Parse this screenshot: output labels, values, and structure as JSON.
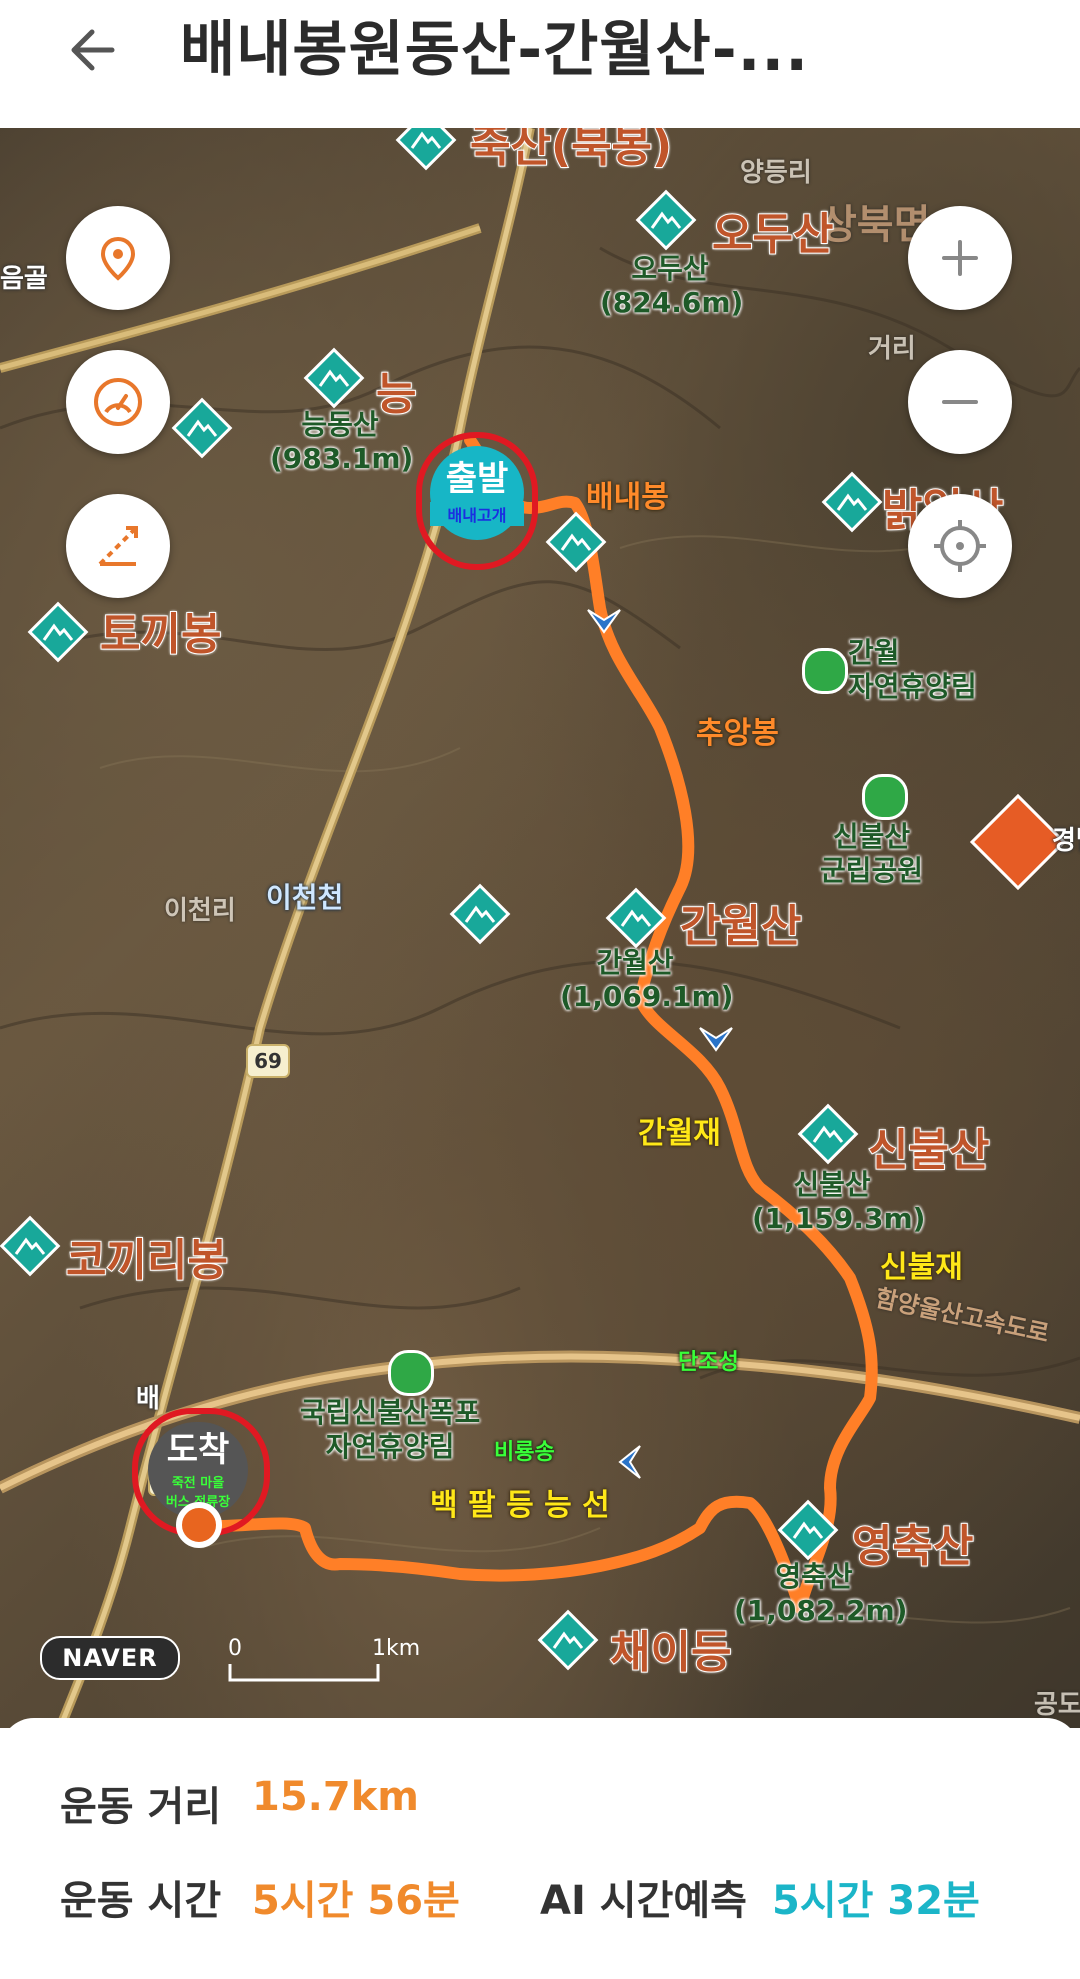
{
  "header": {
    "title": "배내봉원동산-간월산-...",
    "back_icon": "arrow-left-icon"
  },
  "map": {
    "peaks": [
      {
        "id": "juksan",
        "name": "죽산(북봉)"
      },
      {
        "id": "oedusan",
        "name": "오두산",
        "sub": "오두산",
        "elev": "(824.6m)"
      },
      {
        "id": "neungdongsan",
        "name": "능",
        "sub": "능동산",
        "elev": "(983.1m)"
      },
      {
        "id": "balsan",
        "name": "밝얼산"
      },
      {
        "id": "tokkibong",
        "name": "토끼봉"
      },
      {
        "id": "ganwolsan",
        "name": "간월산",
        "sub": "간월산",
        "elev": "(1,069.1m)"
      },
      {
        "id": "sinbulsan",
        "name": "신불산",
        "sub": "신불산",
        "elev": "(1,159.3m)"
      },
      {
        "id": "kokkiribong",
        "name": "코끼리봉"
      },
      {
        "id": "yeongchuksan",
        "name": "영축산",
        "sub": "영축산",
        "elev": "(1,082.2m)"
      },
      {
        "id": "chaeideung",
        "name": "채이등"
      }
    ],
    "places": {
      "yangdeungri": "양등리",
      "sangbukmyeon": "상북면",
      "geori": "거리",
      "eumgol": "음골",
      "icheonri": "이천리",
      "icheoncheon": "이천천",
      "ganwol_forest": "간월\n자연휴양림",
      "sinbul_park": "신불산\n군립공원",
      "gyeong": "경남",
      "sinbul_falls": "국립신불산폭포\n자연휴양림",
      "highway": "함양울산고속도로",
      "bae": "배",
      "godo": "공도"
    },
    "route_labels": {
      "baenaebong": "배내봉",
      "chuangbong": "추앙봉",
      "ganwoljae": "간월재",
      "sinbuljae": "신불재",
      "danjoseong": "단조성",
      "birongsong": "비룡송",
      "baekpal": "백 팔 등 능 선"
    },
    "start": {
      "label": "출발",
      "sub": "배내고개"
    },
    "end": {
      "label": "도착",
      "sub1": "죽전 마을",
      "sub2": "버스 정류장"
    },
    "road_number": "69",
    "naver_logo": "NAVER",
    "scale": {
      "zero": "0",
      "km": "1km"
    },
    "buttons": {
      "location": "location-pin-icon",
      "speedometer": "speedometer-icon",
      "measure": "ruler-measure-icon",
      "zoom_in": "plus-icon",
      "zoom_out": "minus-icon",
      "current_position": "crosshair-icon"
    }
  },
  "stats": {
    "distance_label": "운동 거리",
    "distance_value": "15.7km",
    "time_label": "운동 시간",
    "time_value": "5시간 56분",
    "ai_label": "AI 시간예측",
    "ai_value": "5시간 32분"
  },
  "colors": {
    "route": "#ff7f27",
    "accent_orange": "#f08a2c",
    "accent_teal": "#1bb5c8",
    "peak_icon": "#18a89a",
    "marker_border": "#e01922"
  }
}
